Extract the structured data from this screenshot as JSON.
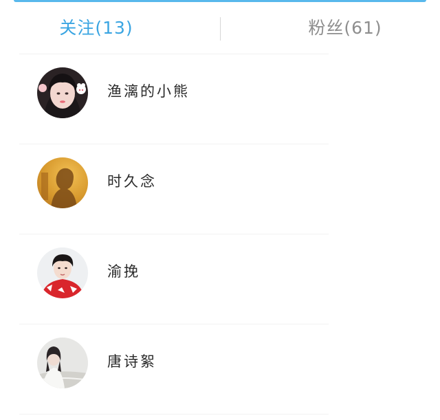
{
  "tabs": {
    "follow_label": "关注(13)",
    "fans_label": "粉丝(61)"
  },
  "users": [
    {
      "name": "渔漓的小熊",
      "avatar": "avatar-girl-with-bunny"
    },
    {
      "name": "时久念",
      "avatar": "avatar-silhouette-orange"
    },
    {
      "name": "渝挽",
      "avatar": "avatar-boy-red-jacket"
    },
    {
      "name": "唐诗絮",
      "avatar": "avatar-girl-beach"
    }
  ],
  "colors": {
    "accent": "#3aa5e2",
    "inactive_tab": "#8e8e8e",
    "name_text": "#2b2b2b"
  }
}
